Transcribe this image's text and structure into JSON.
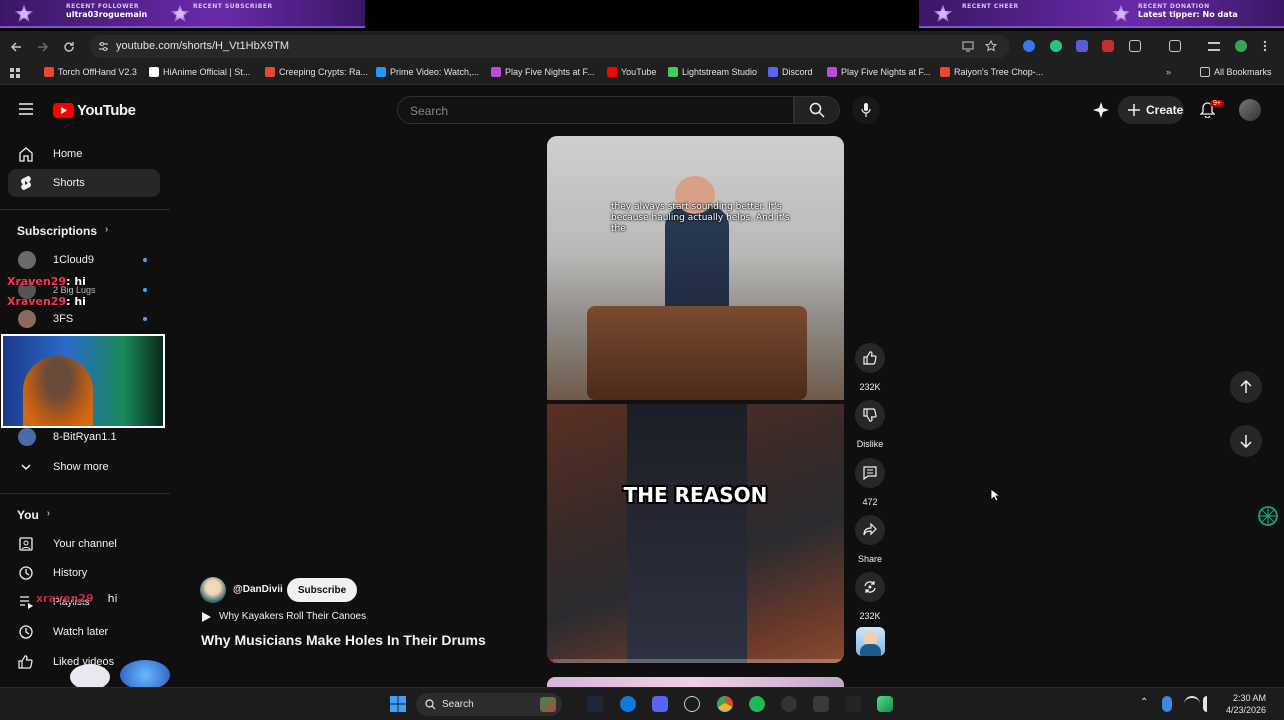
{
  "overlay": {
    "follower_title": "RECENT FOLLOWER",
    "follower_name": "ultra03roguemain",
    "subscriber_title": "RECENT SUBSCRIBER",
    "cheer_title": "RECENT CHEER",
    "donation_title": "RECENT DONATION",
    "donation_value": "Latest tipper: No data"
  },
  "browser": {
    "url": "youtube.com/shorts/H_Vt1HbX9TM",
    "bookmarks": [
      {
        "label": "Torch OffHand V2.3",
        "color": "#e8492f"
      },
      {
        "label": "HiAnime Official | St...",
        "color": "#ffffff"
      },
      {
        "label": "Creeping Crypts: Ra...",
        "color": "#e8492f"
      },
      {
        "label": "Prime Video: Watch,...",
        "color": "#1a98ff"
      },
      {
        "label": "Play Five Nights at F...",
        "color": "#c04bd8"
      },
      {
        "label": "YouTube",
        "color": "#ff0000"
      },
      {
        "label": "Lightstream Studio",
        "color": "#3ecf5a"
      },
      {
        "label": "Discord",
        "color": "#5865f2"
      },
      {
        "label": "Play Five Nights at F...",
        "color": "#c04bd8"
      },
      {
        "label": "Raiyon's Tree Chop-...",
        "color": "#e8492f"
      }
    ],
    "all_bookmarks": "All Bookmarks"
  },
  "header": {
    "logo_text": "YouTube",
    "search_placeholder": "Search",
    "create_label": "Create",
    "notif_count": "9+"
  },
  "sidebar": {
    "home": "Home",
    "shorts": "Shorts",
    "subscriptions_heading": "Subscriptions",
    "subscriptions": [
      {
        "name": "1Cloud9",
        "color": "#6a6a6a"
      },
      {
        "name": "2 Big Lugs",
        "color": "#555555"
      },
      {
        "name": "3FS",
        "color": "#8a6a5a"
      },
      {
        "name": "8-BitRyan1.1",
        "color": "#4a6aa8"
      }
    ],
    "show_more": "Show more",
    "you_heading": "You",
    "you_items": [
      "Your channel",
      "History",
      "Playlists",
      "Watch later",
      "Liked videos"
    ]
  },
  "chat": [
    {
      "user": "Xraven29",
      "message": ": hi"
    },
    {
      "user": "Xraven29",
      "message": ": hi"
    },
    {
      "user": "xraven29",
      "message": "hi"
    }
  ],
  "short": {
    "caption_top": "they always start sounding better. It's because hauling actually helps. And it's the",
    "caption_big": "THE REASON",
    "progress": 0.02,
    "channel": "@DanDivii",
    "subscribe_label": "Subscribe",
    "playlist": "Why Kayakers Roll Their Canoes",
    "title": "Why Musicians Make Holes In Their Drums"
  },
  "actions": {
    "likes": "232K",
    "dislike_label": "Dislike",
    "comments": "472",
    "share_label": "Share",
    "remix_count": "232K"
  },
  "taskbar": {
    "search_label": "Search",
    "time": "2:30 AM",
    "date": "4/23/2026"
  },
  "colors": {
    "accent_red": "#ff0000",
    "background": "#0f0f0f",
    "chip": "#272727"
  }
}
